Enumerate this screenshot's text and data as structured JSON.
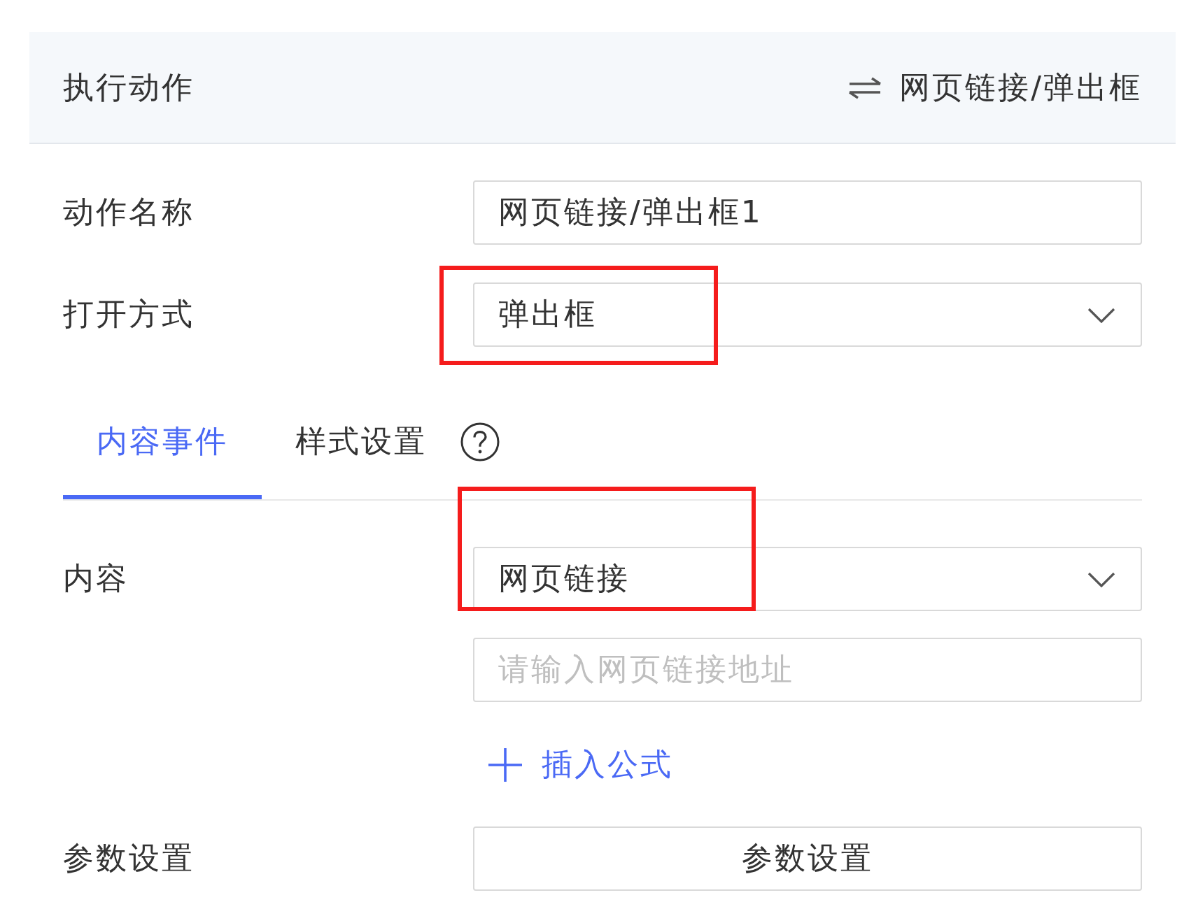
{
  "header": {
    "title": "执行动作",
    "action": {
      "label": "网页链接/弹出框"
    }
  },
  "fields": [
    {
      "label": "动作名称",
      "control": {
        "kind": "input",
        "value": "网页链接/弹出框1"
      },
      "highlighted": false
    },
    {
      "label": "打开方式",
      "control": {
        "kind": "select",
        "value": "弹出框"
      },
      "highlighted": true
    }
  ],
  "tabs": [
    {
      "label": "内容事件",
      "selected": true
    },
    {
      "label": "样式设置",
      "selected": false
    }
  ],
  "content_fields": [
    {
      "label": "内容",
      "control": {
        "kind": "select",
        "value": "网页链接"
      },
      "highlighted": true
    },
    {
      "control": {
        "kind": "input",
        "placeholder": "请输入网页链接地址"
      },
      "highlighted": false
    },
    {
      "control": {
        "kind": "link",
        "label": "插入公式"
      },
      "highlighted": false
    },
    {
      "label": "参数设置",
      "control": {
        "kind": "button",
        "label": "参数设置"
      },
      "highlighted": false
    }
  ]
}
